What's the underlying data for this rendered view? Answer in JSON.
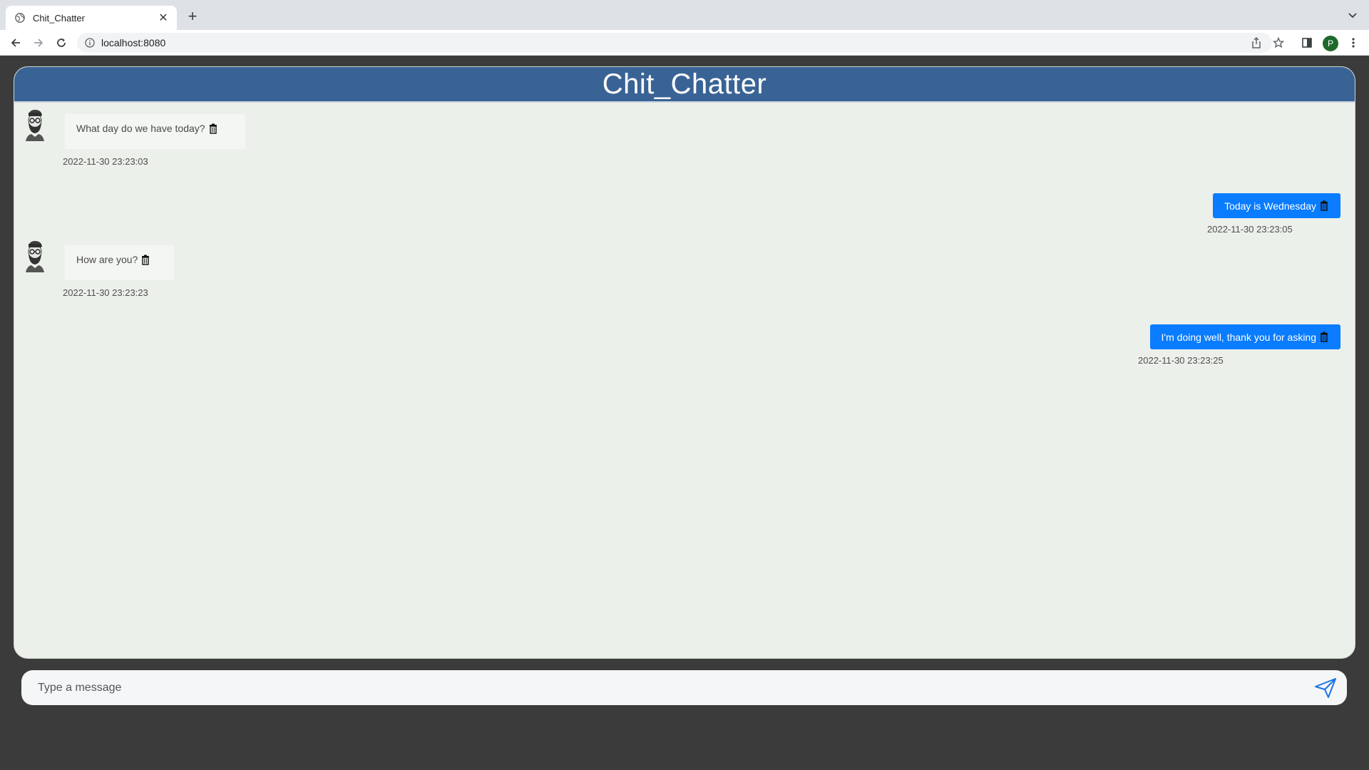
{
  "browser": {
    "tab_title": "Chit_Chatter",
    "tab_close": "✕",
    "new_tab": "+",
    "url": "localhost:8080",
    "profile_initial": "P"
  },
  "app": {
    "title": "Chit_Chatter",
    "header_color": "#3a6395",
    "outgoing_color": "#0a7cff"
  },
  "messages": [
    {
      "direction": "incoming",
      "text": "What day do we have today?",
      "timestamp": "2022-11-30 23:23:03"
    },
    {
      "direction": "outgoing",
      "text": "Today is Wednesday",
      "timestamp": "2022-11-30 23:23:05"
    },
    {
      "direction": "incoming",
      "text": "How are you?",
      "timestamp": "2022-11-30 23:23:23"
    },
    {
      "direction": "outgoing",
      "text": "I'm doing well, thank you for asking",
      "timestamp": "2022-11-30 23:23:25"
    }
  ],
  "composer": {
    "placeholder": "Type a message",
    "value": ""
  },
  "icons": {
    "delete": "trash-icon",
    "send": "send-icon",
    "avatar": "bearded-man-avatar"
  }
}
